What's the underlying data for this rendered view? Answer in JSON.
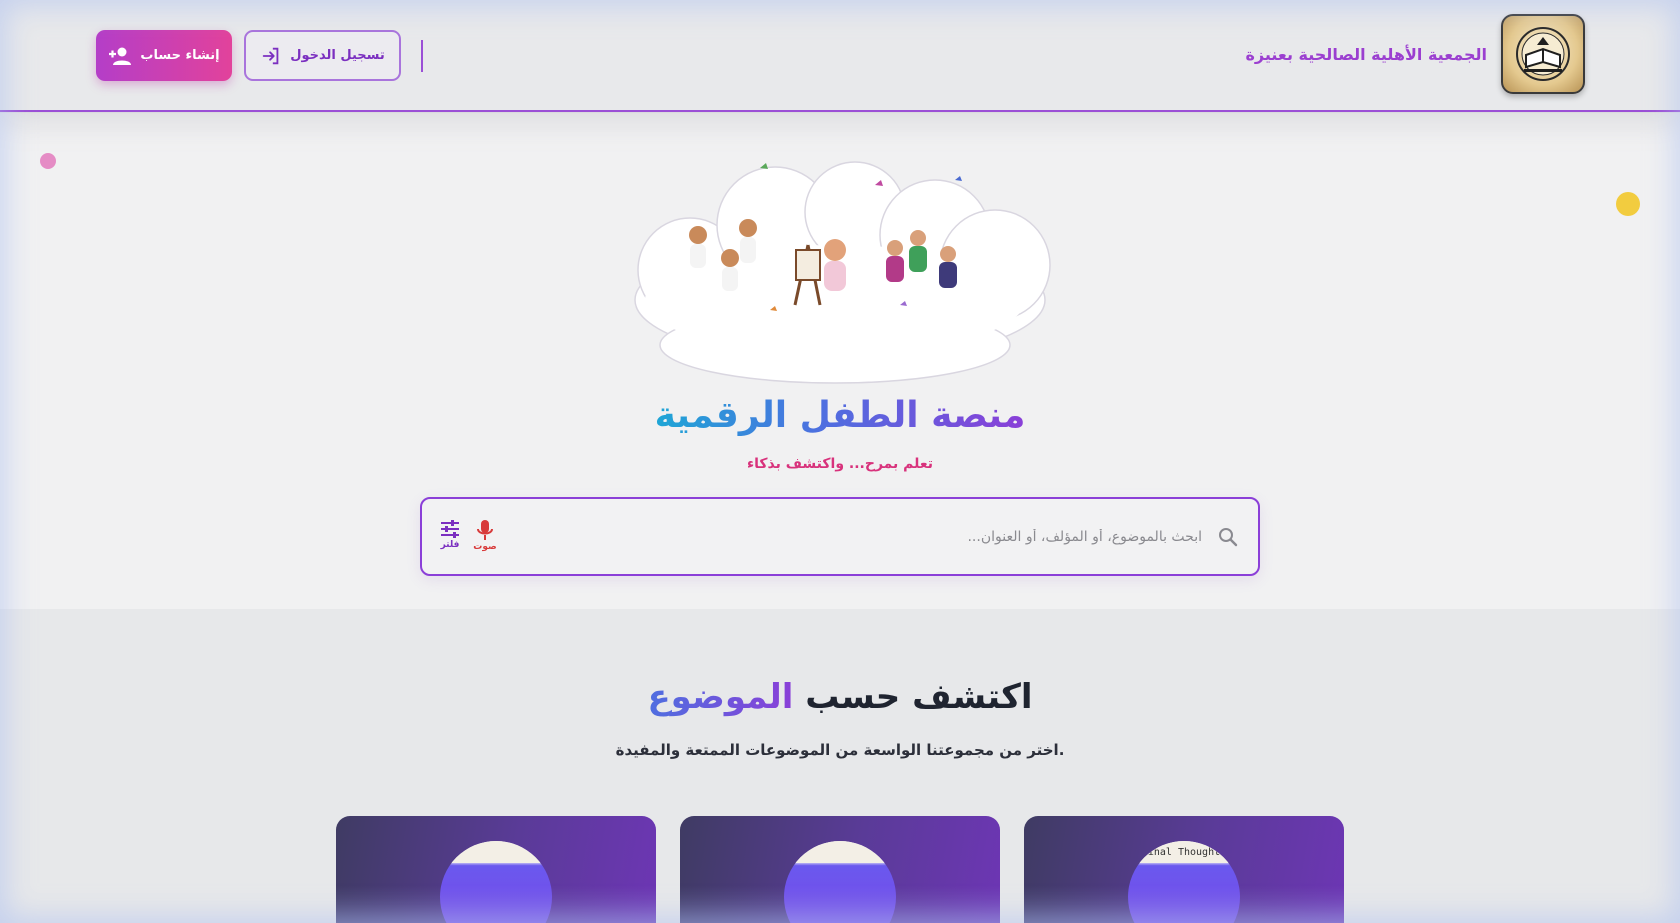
{
  "header": {
    "org_name": "الجمعية الأهلية الصالحية بعنيزة",
    "login_label": "تسجيل الدخول",
    "create_account_label": "إنشاء حساب"
  },
  "hero": {
    "title": "منصة الطفل الرقمية",
    "tagline": "تعلم بمرح... واكتشف بذكاء",
    "search_placeholder": "ابحث بالموضوع، أو المؤلف، أو العنوان...",
    "voice_label": "صوت",
    "filter_label": "فلتر"
  },
  "topics": {
    "title_main": "اكتشف حسب",
    "title_accent": "الموضوع",
    "subtitle": "اختر من مجموعتنا الواسعة من الموضوعات الممتعة والمفيدة.",
    "cards": [
      {
        "caption": ""
      },
      {
        "caption": ""
      },
      {
        "caption": "Final Thoughts"
      }
    ]
  },
  "colors": {
    "primary_purple": "#8b3fd8",
    "accent_pink": "#e2429b",
    "title_blue": "#1ea6d6",
    "tagline_pink": "#d8327c",
    "voice_red": "#d83a3a"
  },
  "icons": {
    "create_account": "user-plus-icon",
    "login": "login-arrow-icon",
    "search": "search-icon",
    "voice": "microphone-icon",
    "filter": "sliders-icon"
  }
}
